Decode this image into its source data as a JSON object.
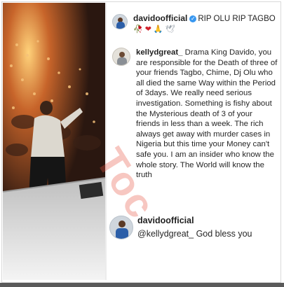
{
  "post": {
    "author": "davidoofficial",
    "caption": "RIP OLU RIP TAGBO",
    "emojis": [
      {
        "icon": "rose-icon",
        "glyph": "🥀"
      },
      {
        "icon": "heart-icon",
        "glyph": "❤"
      },
      {
        "icon": "folded-hands-icon",
        "glyph": "🙏"
      },
      {
        "icon": "dove-icon",
        "glyph": "🕊"
      }
    ]
  },
  "comments": [
    {
      "username": "kellydgreat_",
      "text": "Drama King Davido, you are responsible for the Death of three of your friends Tagbo, Chime, Dj Olu who all died the same Way within the Period of 3days. We really need serious investigation. Something is fishy about the Mysterious death of 3 of your friends in less than a week. The rich always get away with murder cases in Nigeria but this time your Money can't safe you. I am an insider who know the whole story. The World will know the truth"
    },
    {
      "username": "davidoofficial",
      "text": "@kellydgreat_ God bless you"
    }
  ],
  "watermark": "Toc",
  "colors": {
    "verified": "#3797f0",
    "watermark": "#e85442",
    "text": "#262626"
  }
}
